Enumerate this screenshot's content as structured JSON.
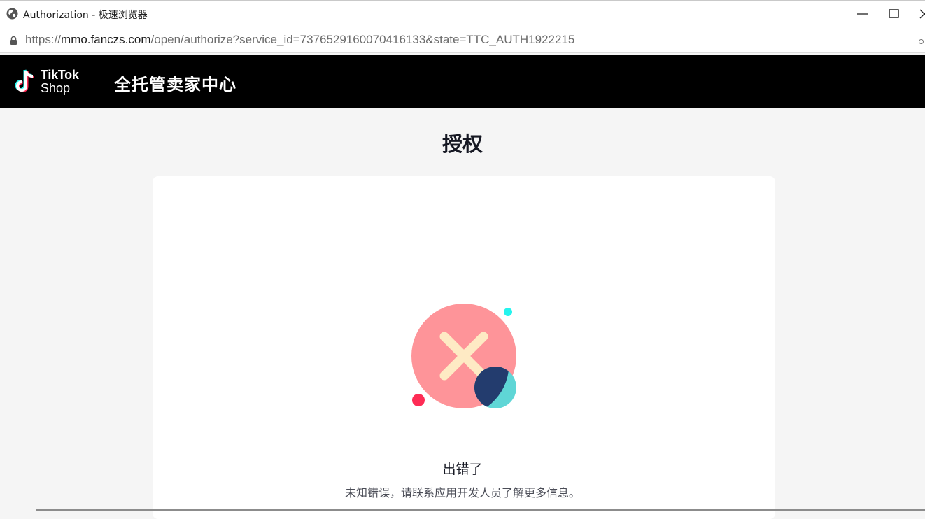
{
  "window": {
    "title": "Authorization - 极速浏览器",
    "controls": [
      "minimize-icon",
      "maximize-icon",
      "close-icon"
    ]
  },
  "address_bar": {
    "url_prefix": "https://",
    "url_host": "mmo.fanczs.com",
    "url_path": "/open/authorize?service_id=7376529160070416133&state=TTC_AUTH1922215",
    "lock_icon": "lock-icon"
  },
  "header": {
    "brand_line1": "TikTok",
    "brand_line2": "Shop",
    "title": "全托管卖家中心"
  },
  "page": {
    "title": "授权"
  },
  "error": {
    "title": "出错了",
    "description": "未知错误，请联系应用开发人员了解更多信息。",
    "icon": "error-x-icon"
  },
  "colors": {
    "header_bg": "#000000",
    "page_bg": "#f5f5f5",
    "circle_pink": "#fe9499",
    "cross": "#feeac4",
    "navy": "#233c6e",
    "teal": "#5fd6d6",
    "dot_cyan": "#25f4ee",
    "dot_magenta": "#fe2c55"
  }
}
